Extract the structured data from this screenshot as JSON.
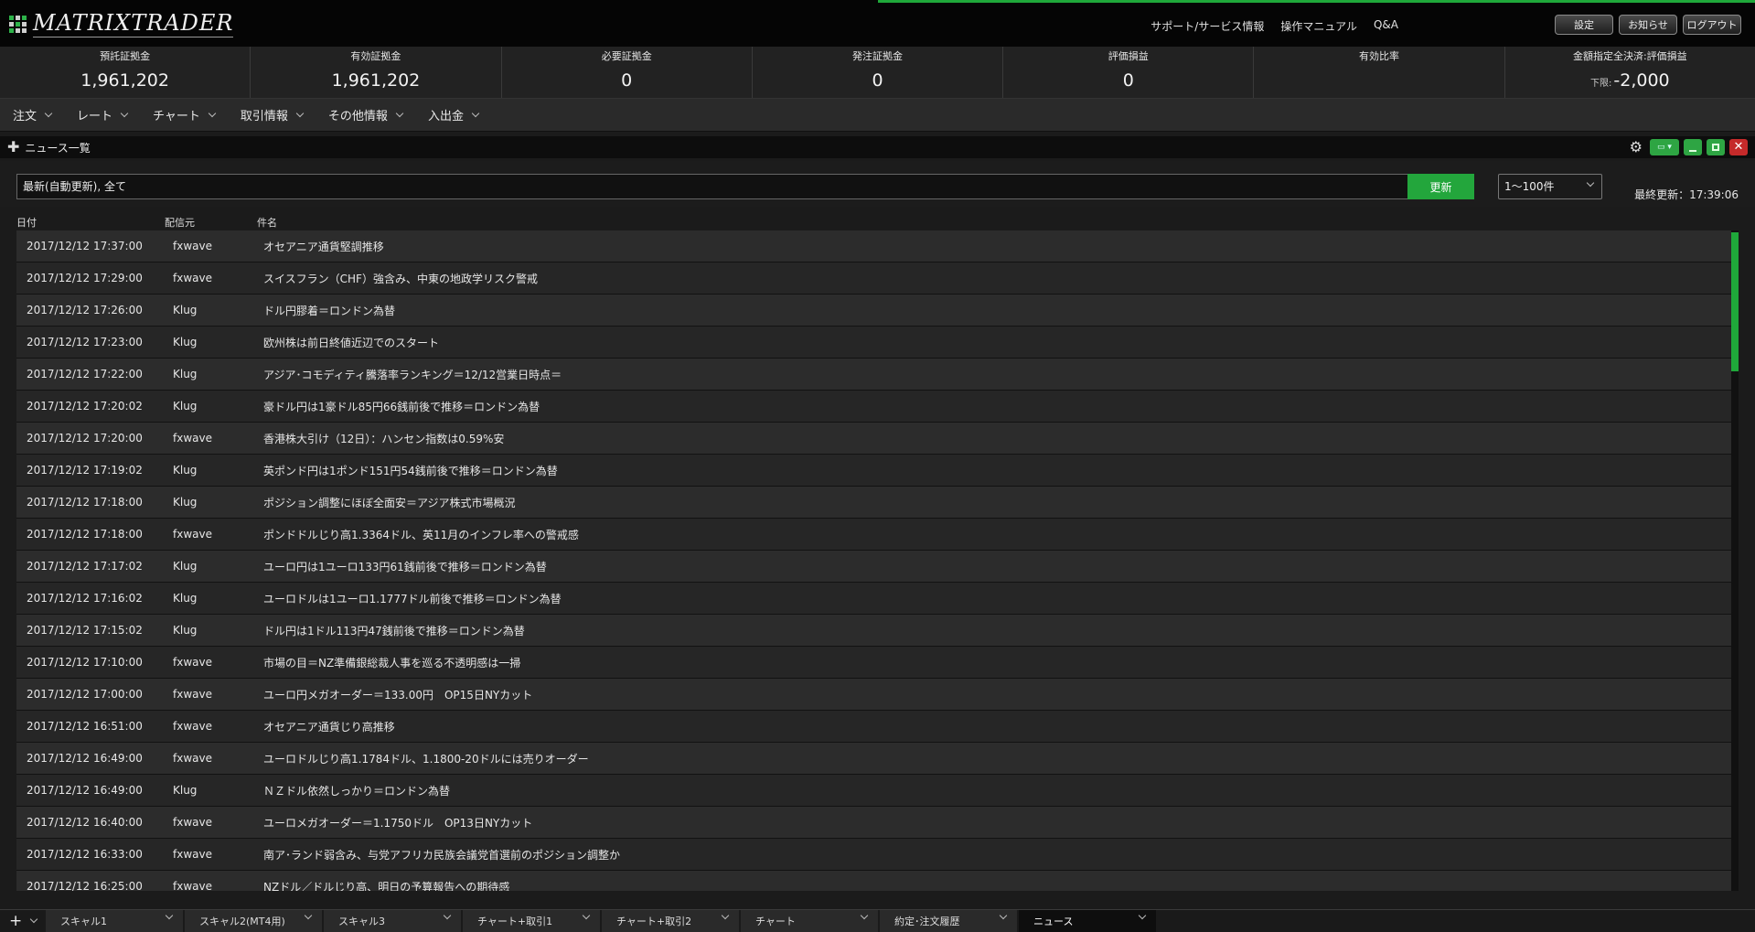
{
  "app": {
    "logo_text": "MATRIXTRADER"
  },
  "header": {
    "links": [
      "サポート/サービス情報",
      "操作マニュアル",
      "Q&A"
    ],
    "buttons": {
      "settings": "設定",
      "notice": "お知らせ",
      "logout": "ログアウト"
    }
  },
  "summary": [
    {
      "label": "預託証拠金",
      "value": "1,961,202"
    },
    {
      "label": "有効証拠金",
      "value": "1,961,202"
    },
    {
      "label": "必要証拠金",
      "value": "0"
    },
    {
      "label": "発注証拠金",
      "value": "0"
    },
    {
      "label": "評価損益",
      "value": "0"
    },
    {
      "label": "有効比率",
      "value": ""
    },
    {
      "label": "金額指定全決済:評価損益",
      "sub": "下限:",
      "value": "-2,000"
    }
  ],
  "menu": [
    "注文",
    "レート",
    "チャート",
    "取引情報",
    "その他情報",
    "入出金"
  ],
  "panel": {
    "title": "ニュース一覧"
  },
  "filter": {
    "value": "最新(自動更新), 全て",
    "update_label": "更新",
    "range_label": "1～100件",
    "last_update": "最終更新：17:39:06"
  },
  "columns": {
    "date": "日付",
    "source": "配信元",
    "title": "件名"
  },
  "news": [
    {
      "date": "2017/12/12 17:37:00",
      "source": "fxwave",
      "title": "オセアニア通貨堅調推移"
    },
    {
      "date": "2017/12/12 17:29:00",
      "source": "fxwave",
      "title": "スイスフラン（CHF）強含み、中東の地政学リスク警戒"
    },
    {
      "date": "2017/12/12 17:26:00",
      "source": "Klug",
      "title": "ドル円膠着＝ロンドン為替"
    },
    {
      "date": "2017/12/12 17:23:00",
      "source": "Klug",
      "title": "欧州株は前日終値近辺でのスタート"
    },
    {
      "date": "2017/12/12 17:22:00",
      "source": "Klug",
      "title": "アジア･コモディティ騰落率ランキング＝12/12営業日時点＝"
    },
    {
      "date": "2017/12/12 17:20:02",
      "source": "Klug",
      "title": "豪ドル円は1豪ドル85円66銭前後で推移＝ロンドン為替"
    },
    {
      "date": "2017/12/12 17:20:00",
      "source": "fxwave",
      "title": "香港株大引け（12日）：ハンセン指数は0.59%安"
    },
    {
      "date": "2017/12/12 17:19:02",
      "source": "Klug",
      "title": "英ポンド円は1ポンド151円54銭前後で推移＝ロンドン為替"
    },
    {
      "date": "2017/12/12 17:18:00",
      "source": "Klug",
      "title": "ポジション調整にほぼ全面安＝アジア株式市場概況"
    },
    {
      "date": "2017/12/12 17:18:00",
      "source": "fxwave",
      "title": "ポンドドルじり高1.3364ドル、英11月のインフレ率への警戒感"
    },
    {
      "date": "2017/12/12 17:17:02",
      "source": "Klug",
      "title": "ユーロ円は1ユーロ133円61銭前後で推移＝ロンドン為替"
    },
    {
      "date": "2017/12/12 17:16:02",
      "source": "Klug",
      "title": "ユーロドルは1ユーロ1.1777ドル前後で推移＝ロンドン為替"
    },
    {
      "date": "2017/12/12 17:15:02",
      "source": "Klug",
      "title": "ドル円は1ドル113円47銭前後で推移＝ロンドン為替"
    },
    {
      "date": "2017/12/12 17:10:00",
      "source": "fxwave",
      "title": "市場の目＝NZ準備銀総裁人事を巡る不透明感は一掃"
    },
    {
      "date": "2017/12/12 17:00:00",
      "source": "fxwave",
      "title": "ユーロ円メガオーダー＝133.00円　OP15日NYカット"
    },
    {
      "date": "2017/12/12 16:51:00",
      "source": "fxwave",
      "title": "オセアニア通貨じり高推移"
    },
    {
      "date": "2017/12/12 16:49:00",
      "source": "fxwave",
      "title": "ユーロドルじり高1.1784ドル、1.1800-20ドルには売りオーダー"
    },
    {
      "date": "2017/12/12 16:49:00",
      "source": "Klug",
      "title": "ＮＺドル依然しっかり＝ロンドン為替"
    },
    {
      "date": "2017/12/12 16:40:00",
      "source": "fxwave",
      "title": "ユーロメガオーダー＝1.1750ドル　OP13日NYカット"
    },
    {
      "date": "2017/12/12 16:33:00",
      "source": "fxwave",
      "title": "南ア･ランド弱含み、与党アフリカ民族会議党首選前のポジション調整か"
    },
    {
      "date": "2017/12/12 16:25:00",
      "source": "fxwave",
      "title": "NZドル／ドルじり高、明日の予算報告への期待感"
    }
  ],
  "tabs": [
    {
      "label": "スキャル1"
    },
    {
      "label": "スキャル2(MT4用)"
    },
    {
      "label": "スキャル3"
    },
    {
      "label": "チャート+取引1"
    },
    {
      "label": "チャート+取引2"
    },
    {
      "label": "チャート"
    },
    {
      "label": "約定･注文履歴"
    },
    {
      "label": "ニュース",
      "active": true
    }
  ]
}
